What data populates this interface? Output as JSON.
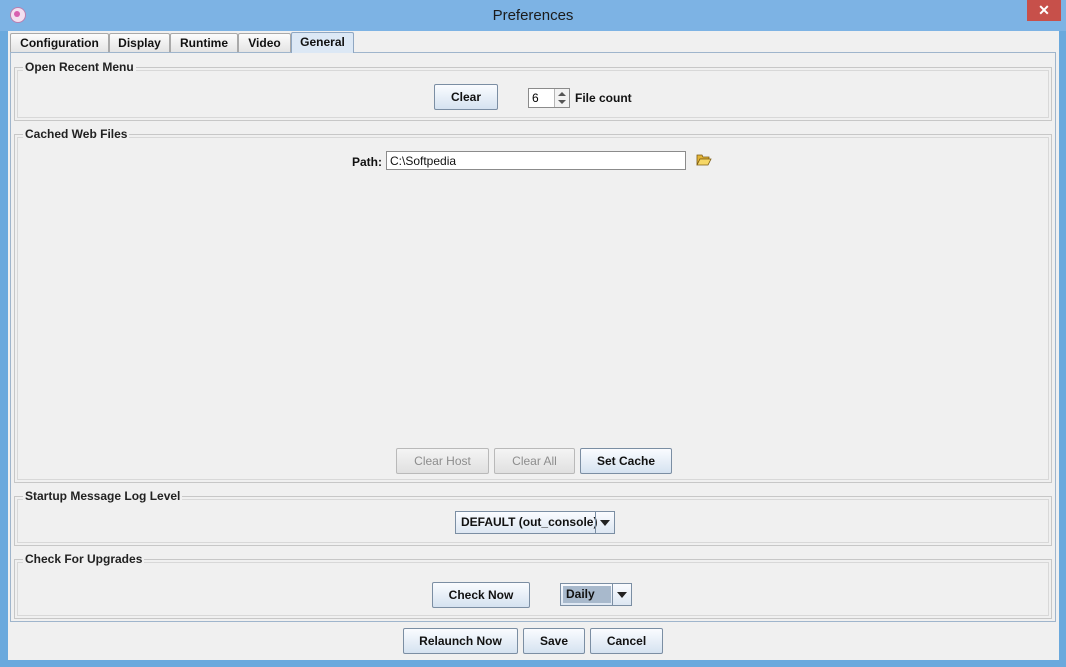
{
  "window": {
    "title": "Preferences",
    "close_glyph": "✕"
  },
  "tabs": [
    {
      "label": "Configuration"
    },
    {
      "label": "Display"
    },
    {
      "label": "Runtime"
    },
    {
      "label": "Video"
    },
    {
      "label": "General",
      "active": true
    }
  ],
  "open_recent": {
    "title": "Open Recent Menu",
    "clear_label": "Clear",
    "file_count_value": "6",
    "file_count_label": "File count"
  },
  "cached_web_files": {
    "title": "Cached Web Files",
    "path_label": "Path:",
    "path_value": "C:\\Softpedia",
    "browse_icon": "folder-open-icon",
    "clear_host_label": "Clear Host",
    "clear_all_label": "Clear All",
    "set_cache_label": "Set Cache"
  },
  "startup_log": {
    "title": "Startup Message Log Level",
    "selected": "DEFAULT (out_console)"
  },
  "upgrades": {
    "title": "Check For Upgrades",
    "check_now_label": "Check Now",
    "frequency_selected": "Daily"
  },
  "footer": {
    "relaunch_label": "Relaunch Now",
    "save_label": "Save",
    "cancel_label": "Cancel"
  },
  "colors": {
    "title_bar": "#7db3e4",
    "close_button": "#c7504a",
    "dialog_background": "#f0f0f0",
    "button_gradient_bottom": "#d5e2f0"
  }
}
